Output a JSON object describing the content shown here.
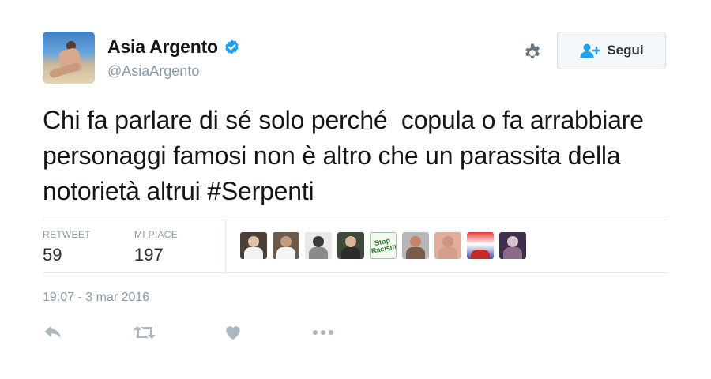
{
  "author": {
    "name": "Asia Argento",
    "handle": "@AsiaArgento",
    "verified": true
  },
  "header": {
    "follow_label": "Segui"
  },
  "tweet": {
    "text_before": "Chi fa parlare di sé solo perché  copula o fa arrabbiare personaggi famosi non è altro che un parassita della notorietà altrui ",
    "hashtag": "#Serpenti",
    "timestamp": "19:07 - 3 mar 2016"
  },
  "stats": {
    "retweet_label": "RETWEET",
    "retweet_count": "59",
    "likes_label": "MI PIACE",
    "likes_count": "197"
  },
  "likers": [
    {
      "name": "liker-avatar-1"
    },
    {
      "name": "liker-avatar-2"
    },
    {
      "name": "liker-avatar-3"
    },
    {
      "name": "liker-avatar-4"
    },
    {
      "name": "liker-avatar-5",
      "text": "Stop Racism"
    },
    {
      "name": "liker-avatar-6"
    },
    {
      "name": "liker-avatar-7"
    },
    {
      "name": "liker-avatar-8"
    },
    {
      "name": "liker-avatar-9"
    }
  ],
  "icons": {
    "verified": "verified-badge-icon",
    "gear": "gear-icon",
    "follow": "add-user-icon",
    "reply": "reply-icon",
    "retweet": "retweet-icon",
    "like": "heart-icon",
    "more": "more-dots-icon"
  },
  "colors": {
    "accent": "#1da1f2",
    "muted": "#8899a6",
    "icon_gray": "#aab8c2",
    "text": "#14171a"
  }
}
